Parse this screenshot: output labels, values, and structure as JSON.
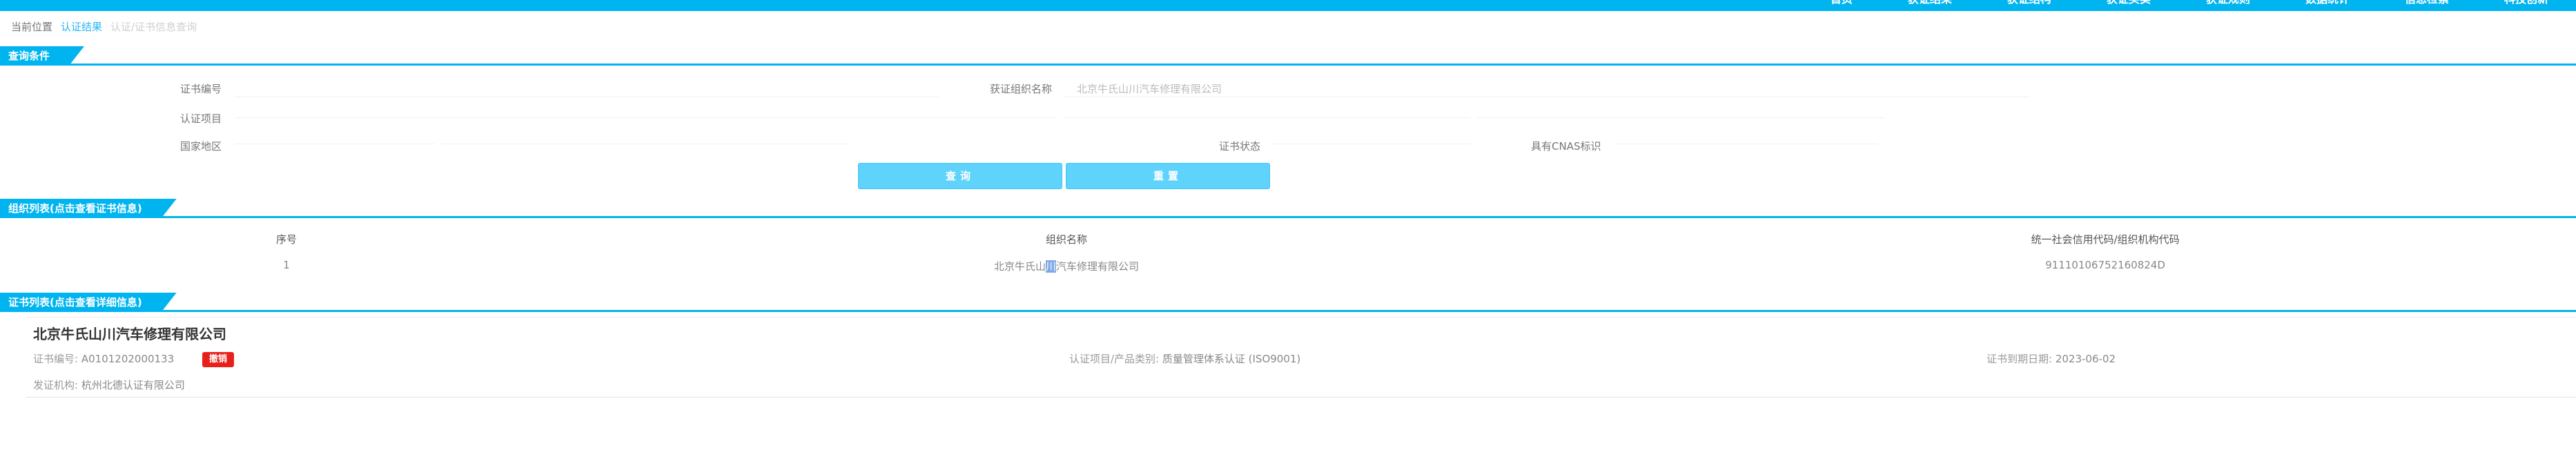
{
  "nav": {
    "items": [
      "首页",
      "获证结果",
      "获证结构",
      "获证买卖",
      "获证规则",
      "数据统计",
      "信息检索",
      "科技创新"
    ]
  },
  "breadcrumb": {
    "current_label": "当前位置",
    "link": "认证结果",
    "last": "认证/证书信息查询"
  },
  "query": {
    "section_title": "查询条件",
    "cert_no_label": "证书编号",
    "org_name_label": "获证组织名称",
    "org_name_value": "北京牛氏山川汽车修理有限公司",
    "project_label": "认证项目",
    "region_label": "国家地区",
    "status_label": "证书状态",
    "cnas_label": "具有CNAS标识",
    "search_button": "查询",
    "reset_button": "重置"
  },
  "org_list": {
    "section_title": "组织列表(点击查看证书信息)",
    "headers": [
      "序号",
      "组织名称",
      "统一社会信用代码/组织机构代码"
    ],
    "rows": [
      {
        "index": "1",
        "name_pre": "北京牛氏山",
        "name_hl": "川",
        "name_post": "汽车修理有限公司",
        "code": "91110106752160824D"
      }
    ]
  },
  "cert_list": {
    "section_title": "证书列表(点击查看详细信息)",
    "cards": [
      {
        "title": "北京牛氏山川汽车修理有限公司",
        "cert_no_label": "证书编号:",
        "cert_no": "A0101202000133",
        "status_badge": "撤销",
        "project_label": "认证项目/产品类别:",
        "project": "质量管理体系认证 (ISO9001)",
        "expiry_label": "证书到期日期:",
        "expiry": "2023-06-02",
        "issuer_label": "发证机构:",
        "issuer": "杭州北德认证有限公司"
      }
    ]
  },
  "colors": {
    "primary": "#00b4f0",
    "button": "#5fd3fb",
    "badge": "#e8201b"
  }
}
